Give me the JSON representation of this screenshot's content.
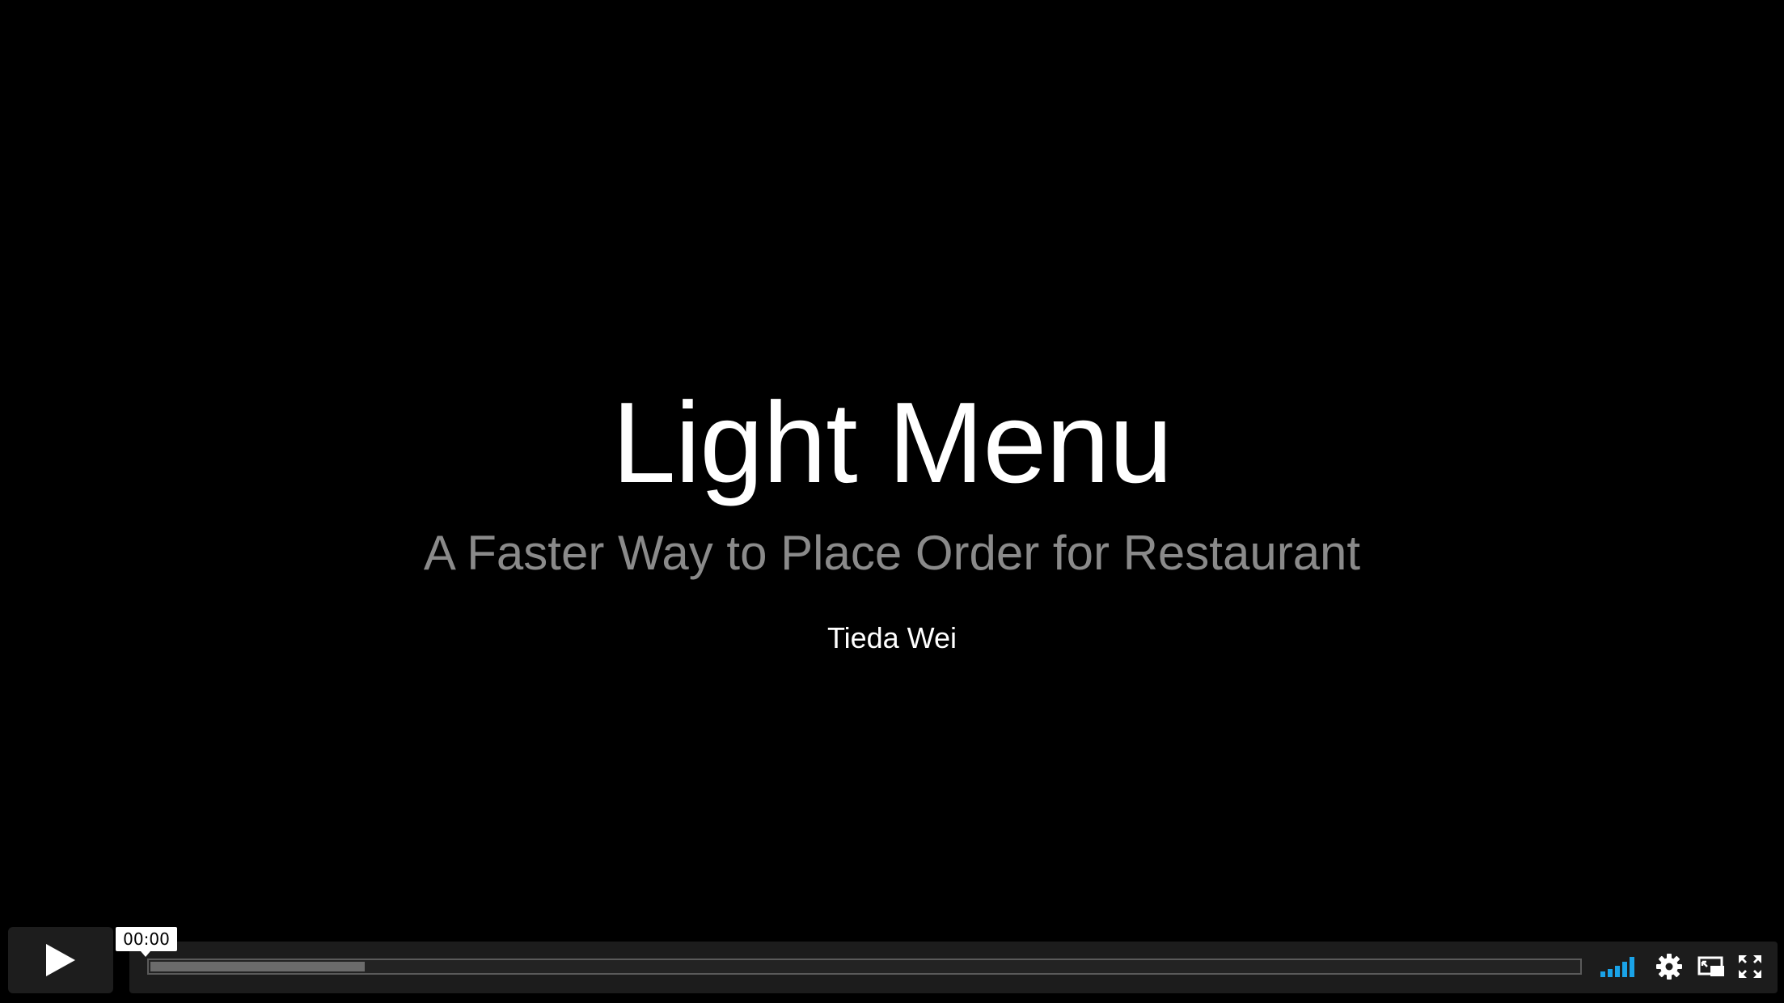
{
  "slide": {
    "title": "Light Menu",
    "subtitle": "A Faster Way to Place Order for Restaurant",
    "author": "Tieda Wei"
  },
  "player": {
    "current_time": "00:00",
    "buffered_fraction": 0.15,
    "played_fraction": 0.0,
    "icons": {
      "play": "play-icon",
      "volume": "volume-icon",
      "settings": "gear-icon",
      "pip": "picture-in-picture-icon",
      "fullscreen": "fullscreen-icon"
    },
    "colors": {
      "background": "#000000",
      "controls": "#1c1c1c",
      "volume_accent": "#1aa3e8",
      "buffer": "#6b6b6b",
      "subtitle": "#8a8a8a"
    }
  }
}
